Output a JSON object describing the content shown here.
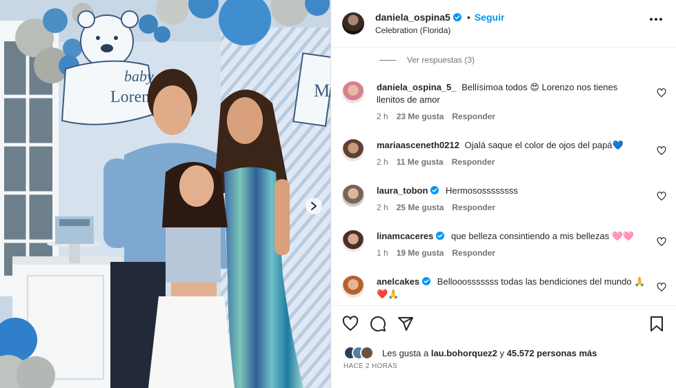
{
  "post": {
    "username": "daniela_ospina5",
    "follow_label": "Seguir",
    "dot": "•",
    "location": "Celebration (Florida)",
    "more_label": "Más opciones"
  },
  "photo": {
    "sign_text_1": "baby",
    "sign_text_2": "Lorenzo",
    "sign_text_3": "M"
  },
  "replies_label": "Ver respuestas (3)",
  "comments": [
    {
      "username": "daniela_ospina_5_",
      "verified": false,
      "text": "Bellísimoa todos 😍 Lorenzo nos tienes llenitos de amor",
      "time": "2 h",
      "likes": "23 Me gusta",
      "reply": "Responder"
    },
    {
      "username": "mariaasceneth0212",
      "verified": false,
      "text": "Ojalá saque el color de ojos del papá💙",
      "time": "2 h",
      "likes": "11 Me gusta",
      "reply": "Responder"
    },
    {
      "username": "laura_tobon",
      "verified": true,
      "text": "Hermosossssssss",
      "time": "2 h",
      "likes": "25 Me gusta",
      "reply": "Responder"
    },
    {
      "username": "linamcaceres",
      "verified": true,
      "text": "que belleza consintiendo a mis bellezas 🩷🩷",
      "time": "1 h",
      "likes": "19 Me gusta",
      "reply": "Responder"
    },
    {
      "username": "anelcakes",
      "verified": true,
      "text": "Bellooosssssss todas las bendiciones del mundo 🙏❤️🙏",
      "time": "",
      "likes": "",
      "reply": ""
    }
  ],
  "likes": {
    "prefix": "Les gusta a",
    "user": "lau.bohorquez2",
    "middle": "y",
    "others": "45.572 personas más"
  },
  "timestamp": "HACE 2 HORAS",
  "colors": {
    "accent": "#0095f6",
    "text": "#262626",
    "secondary": "#737373",
    "verified": "#0095f6"
  },
  "icons": {
    "like": "heart-icon",
    "comment": "comment-icon",
    "share": "share-icon",
    "save": "bookmark-icon",
    "next": "chevron-right-icon",
    "more": "ellipsis-icon"
  }
}
